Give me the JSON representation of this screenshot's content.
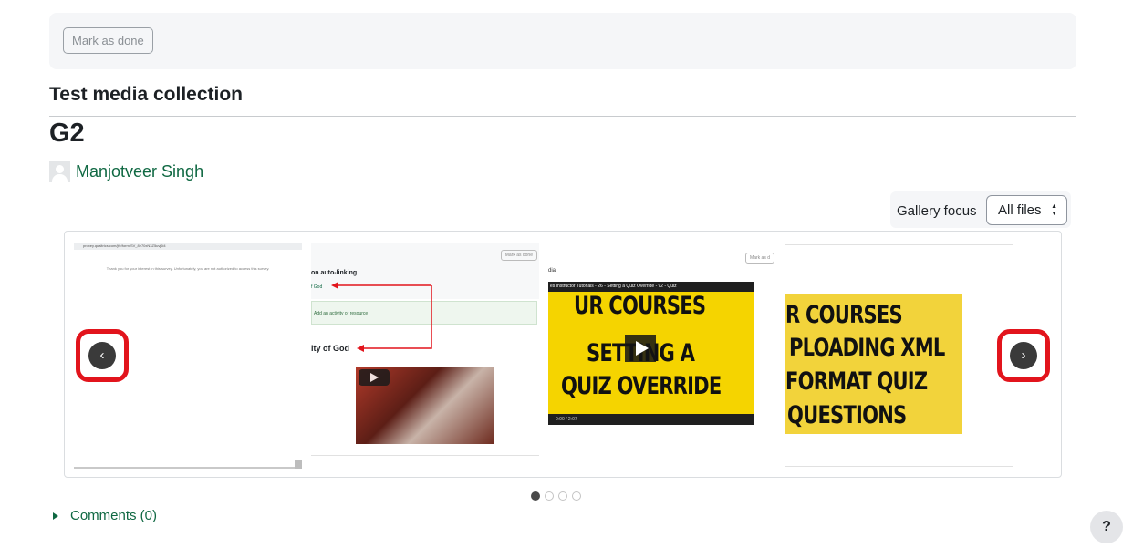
{
  "top_card": {
    "mark_done_label": "Mark as done"
  },
  "collection_title": "Test media collection",
  "item_title": "G2",
  "author": {
    "name": "Manjotveer Singh"
  },
  "gallery_focus": {
    "label": "Gallery focus",
    "selected": "All files"
  },
  "carousel": {
    "prev_icon": "‹",
    "next_icon": "›",
    "slides": [
      {
        "url": "proxey.qualtrics.com/jfe/form/SV_8e70xN3Z5uvj6i4",
        "message": "Thank you for your interest in this survey. Unfortunately, you are not authorized to access this survey."
      },
      {
        "mini_button": "Mark as done",
        "heading1": "on auto-linking",
        "link": "f God",
        "add_activity": "Add an activity or resource",
        "heading2": "ity of God"
      },
      {
        "mini_button": "Mark as d",
        "label": "dia",
        "video_title": "es Instructor Tutorials - 26 - Setting a Quiz Override - v2 - Quiz",
        "video_line1": "UR COURSES",
        "video_line2": "SETTING A",
        "video_line3": "QUIZ OVERRIDE",
        "video_time": "0:00 / 2:07"
      },
      {
        "poster_lines": [
          "R COURSES",
          "PLOADING XML",
          "FORMAT QUIZ",
          "QUESTIONS"
        ]
      }
    ],
    "page_count": 4,
    "active_page": 1
  },
  "comments": {
    "label": "Comments (0)"
  },
  "help": {
    "label": "?"
  },
  "colors": {
    "accent": "#0f6842",
    "highlight": "#e2141c",
    "video_yellow": "#f5d400"
  }
}
